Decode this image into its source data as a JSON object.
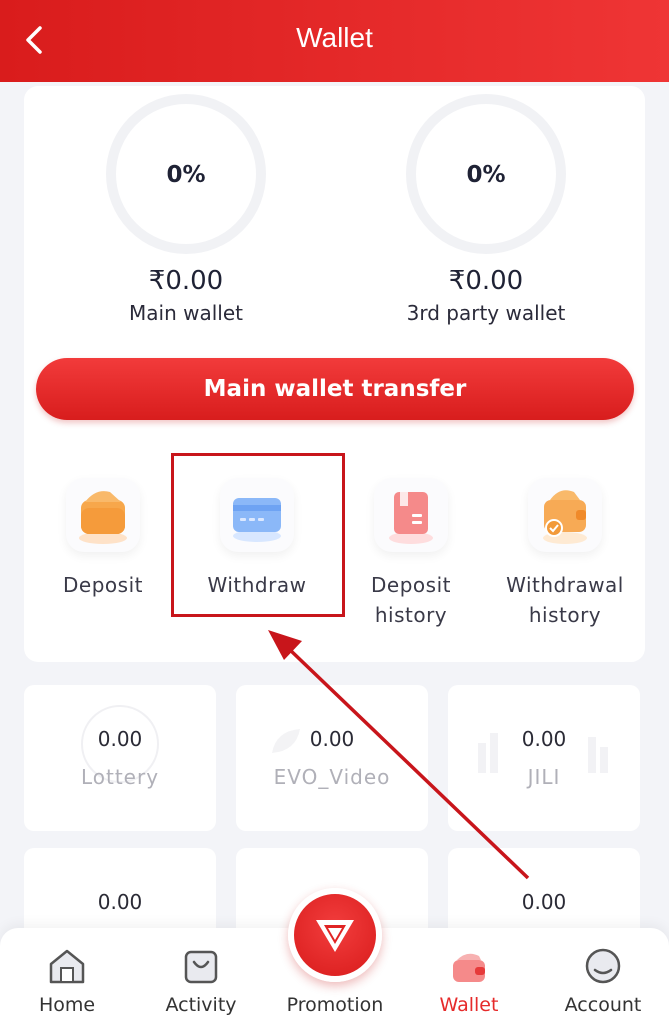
{
  "header": {
    "title": "Wallet"
  },
  "wallets": [
    {
      "percent": "0%",
      "amount": "₹0.00",
      "label": "Main wallet"
    },
    {
      "percent": "0%",
      "amount": "₹0.00",
      "label": "3rd party wallet"
    }
  ],
  "transfer_button": "Main wallet transfer",
  "actions": [
    {
      "label": "Deposit",
      "icon": "deposit-icon"
    },
    {
      "label": "Withdraw",
      "icon": "withdraw-card-icon"
    },
    {
      "label": "Deposit history",
      "icon": "deposit-history-icon"
    },
    {
      "label": "Withdrawal history",
      "icon": "withdrawal-history-icon"
    }
  ],
  "games": [
    {
      "amount": "0.00",
      "name": "Lottery"
    },
    {
      "amount": "0.00",
      "name": "EVO_Video"
    },
    {
      "amount": "0.00",
      "name": "JILI"
    },
    {
      "amount": "0.00",
      "name": ""
    },
    {
      "amount": "",
      "name": ""
    },
    {
      "amount": "0.00",
      "name": ""
    }
  ],
  "tabs": [
    {
      "label": "Home",
      "icon": "home-icon"
    },
    {
      "label": "Activity",
      "icon": "activity-icon"
    },
    {
      "label": "Promotion",
      "icon": "diamond-icon"
    },
    {
      "label": "Wallet",
      "icon": "wallet-icon",
      "active": true
    },
    {
      "label": "Account",
      "icon": "account-icon"
    }
  ],
  "colors": {
    "brand_red": "#e62a2a",
    "highlight_red": "#c8151b"
  }
}
